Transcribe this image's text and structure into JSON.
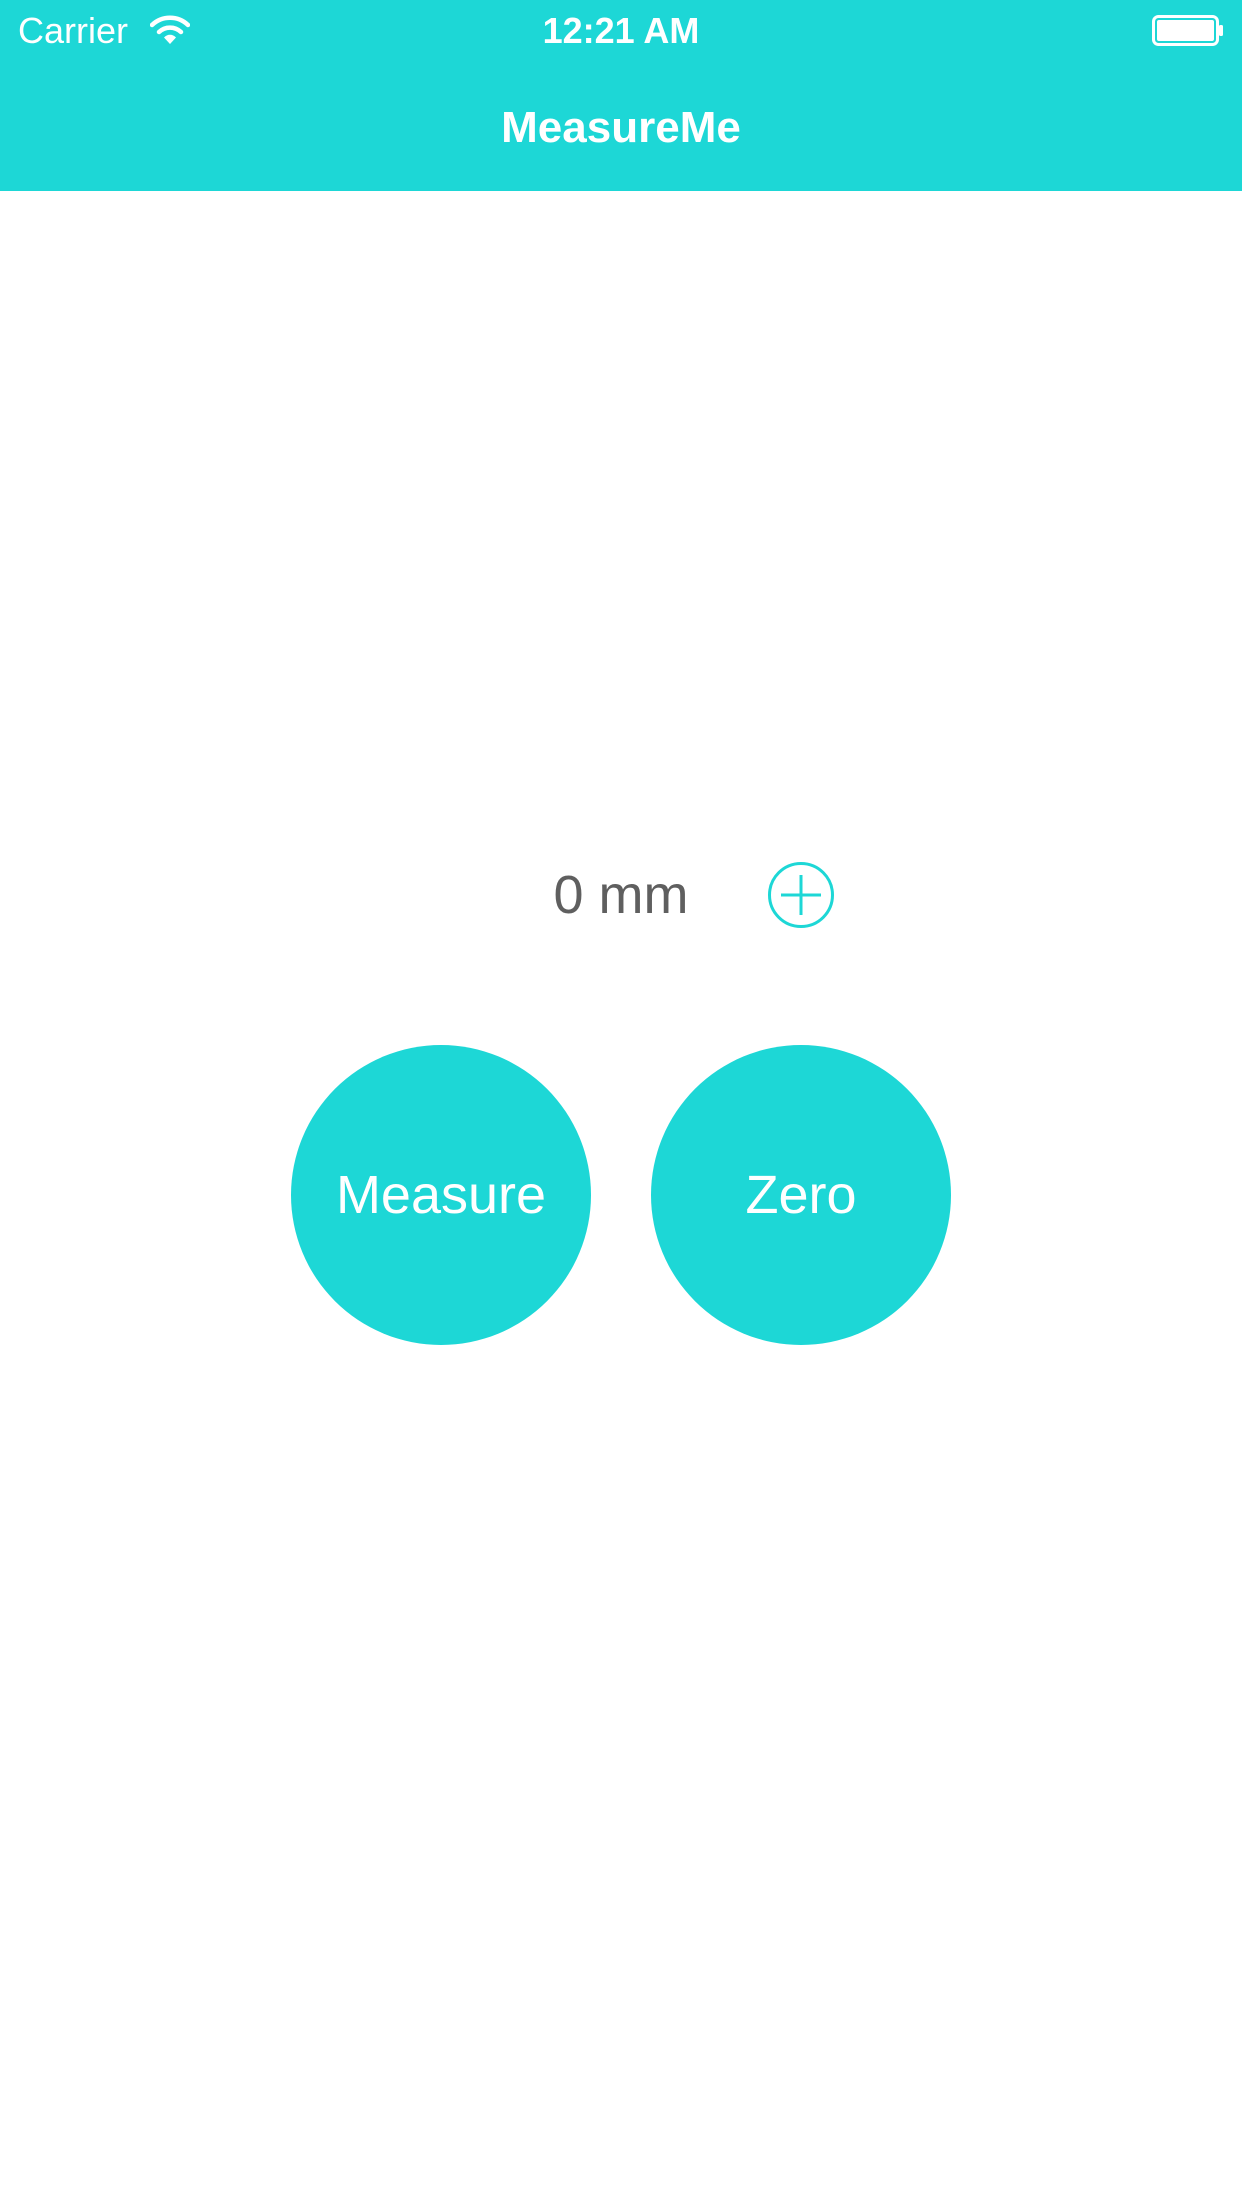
{
  "status_bar": {
    "carrier": "Carrier",
    "time": "12:21 AM",
    "wifi_icon": "wifi-icon",
    "battery_icon": "battery-icon"
  },
  "nav": {
    "title": "MeasureMe"
  },
  "measurement": {
    "value": "0 mm",
    "add_icon": "plus-circle-icon"
  },
  "buttons": {
    "measure_label": "Measure",
    "zero_label": "Zero"
  },
  "colors": {
    "accent": "#1DD7D6",
    "value_text": "#5f5f5f",
    "background": "#ffffff"
  }
}
